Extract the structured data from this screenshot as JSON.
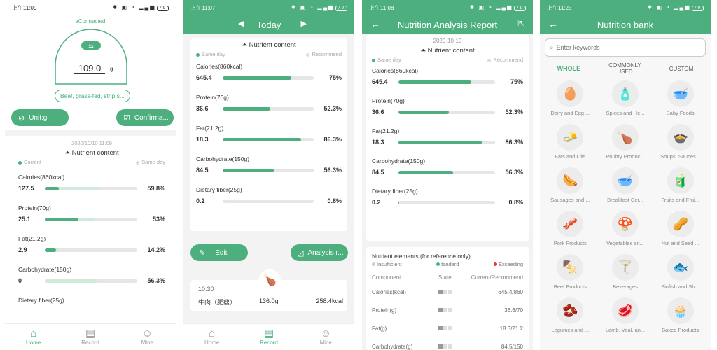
{
  "status": {
    "s1_time": "上午11:09",
    "s2_time": "上午11:07",
    "s3_time": "上午11:08",
    "s4_time": "上午11:23",
    "battery": "79"
  },
  "home": {
    "connected": "Connected",
    "weight": "109.0",
    "unit_small": "g",
    "food_name": "Beef, grass-fed, strip s...",
    "unit_button": "Unit:g",
    "confirm_button": "Confirma...",
    "date": "2020/10/10 11:09",
    "nutrient_title": "Nutrient content",
    "legend_current": "Current",
    "legend_sameday": "Same day",
    "rows": [
      {
        "label": "Calories(860kcal)",
        "value": "127.5",
        "pct": "59.8%",
        "fill": 0.15,
        "under": 0.598
      },
      {
        "label": "Protein(70g)",
        "value": "25.1",
        "pct": "53%",
        "fill": 0.36,
        "under": 0.53
      },
      {
        "label": "Fat(21.2g)",
        "value": "2.9",
        "pct": "14.2%",
        "fill": 0.12,
        "under": 0.142
      },
      {
        "label": "Carbohydrate(150g)",
        "value": "0",
        "pct": "56.3%",
        "fill": 0.0,
        "under": 0.563
      },
      {
        "label": "Dietary fiber(25g)",
        "value": "",
        "pct": "",
        "fill": 0,
        "under": 0
      }
    ]
  },
  "record": {
    "title": "Today",
    "nutrient_title": "Nutrient content",
    "legend_sameday": "Same day",
    "legend_recommend": "Recommend",
    "rows": [
      {
        "label": "Calories(860kcal)",
        "value": "645.4",
        "pct": "75%",
        "fill": 0.75
      },
      {
        "label": "Protein(70g)",
        "value": "36.6",
        "pct": "52.3%",
        "fill": 0.523
      },
      {
        "label": "Fat(21.2g)",
        "value": "18.3",
        "pct": "86.3%",
        "fill": 0.863
      },
      {
        "label": "Carbohydrate(150g)",
        "value": "84.5",
        "pct": "56.3%",
        "fill": 0.563
      },
      {
        "label": "Dietary fiber(25g)",
        "value": "0.2",
        "pct": "0.8%",
        "fill": 0.008
      }
    ],
    "edit_button": "Edit",
    "analysis_button": "Analysis r...",
    "entry_time": "10:30",
    "entry_food": "牛肉（肥瘦）",
    "entry_weight": "136.0g",
    "entry_kcal": "258.4kcal"
  },
  "report": {
    "title": "Nutrition Analysis Report",
    "date": "2020-10-10",
    "nutrient_title": "Nutrient content",
    "legend_sameday": "Same day",
    "legend_recommend": "Recommend",
    "rows": [
      {
        "label": "Calories(860kcal)",
        "value": "645.4",
        "pct": "75%",
        "fill": 0.75
      },
      {
        "label": "Protein(70g)",
        "value": "36.6",
        "pct": "52.3%",
        "fill": 0.523
      },
      {
        "label": "Fat(21.2g)",
        "value": "18.3",
        "pct": "86.3%",
        "fill": 0.863
      },
      {
        "label": "Carbohydrate(150g)",
        "value": "84.5",
        "pct": "56.3%",
        "fill": 0.563
      },
      {
        "label": "Dietary fiber(25g)",
        "value": "0.2",
        "pct": "0.8%",
        "fill": 0.008
      }
    ],
    "elements_title": "Nutrient elements (for reference only)",
    "leg_insufficient": "Insufficient",
    "leg_standard": "tandard",
    "leg_exceeding": "Exceeding",
    "col_component": "Component",
    "col_state": "State",
    "col_current": "Current/Recommend",
    "table": [
      {
        "name": "Calories(kcal)",
        "value": "645.4/860"
      },
      {
        "name": "Protein(g)",
        "value": "36.6/70"
      },
      {
        "name": "Fat(g)",
        "value": "18.3/21.2"
      },
      {
        "name": "Carbohydrate(g)",
        "value": "84.5/150"
      }
    ]
  },
  "bank": {
    "title": "Nutrition bank",
    "search_placeholder": "Enter keywords",
    "tab_whole": "WHOLE",
    "tab_common": "COMMONLY USED",
    "tab_custom": "CUSTOM",
    "items": [
      {
        "label": "Dairy and Egg ...",
        "icon": "🥚"
      },
      {
        "label": "Spices and He...",
        "icon": "🧴"
      },
      {
        "label": "Baby Foods",
        "icon": "🥣"
      },
      {
        "label": "Fats and Oils",
        "icon": "🧈"
      },
      {
        "label": "Poultry Produc...",
        "icon": "🍗"
      },
      {
        "label": "Soups, Sauces...",
        "icon": "🍲"
      },
      {
        "label": "Sausages and ...",
        "icon": "🌭"
      },
      {
        "label": "Breakfast Cer...",
        "icon": "🥣"
      },
      {
        "label": "Fruits and Frui...",
        "icon": "🧃"
      },
      {
        "label": "Pork Products",
        "icon": "🥓"
      },
      {
        "label": "Vegetables an...",
        "icon": "🍄"
      },
      {
        "label": "Nut and Seed ...",
        "icon": "🥜"
      },
      {
        "label": "Beef Products",
        "icon": "🍢"
      },
      {
        "label": "Beverages",
        "icon": "🍸"
      },
      {
        "label": "Finfish and Sh...",
        "icon": "🐟"
      },
      {
        "label": "Legumes and ...",
        "icon": "🫘"
      },
      {
        "label": "Lamb, Veal, an...",
        "icon": "🥩"
      },
      {
        "label": "Baked Products",
        "icon": "🧁"
      }
    ]
  },
  "tabs": {
    "home": "Home",
    "record": "Record",
    "mine": "Mine"
  },
  "colors": {
    "accent": "#4caf7d",
    "exceeding": "#e53935"
  }
}
